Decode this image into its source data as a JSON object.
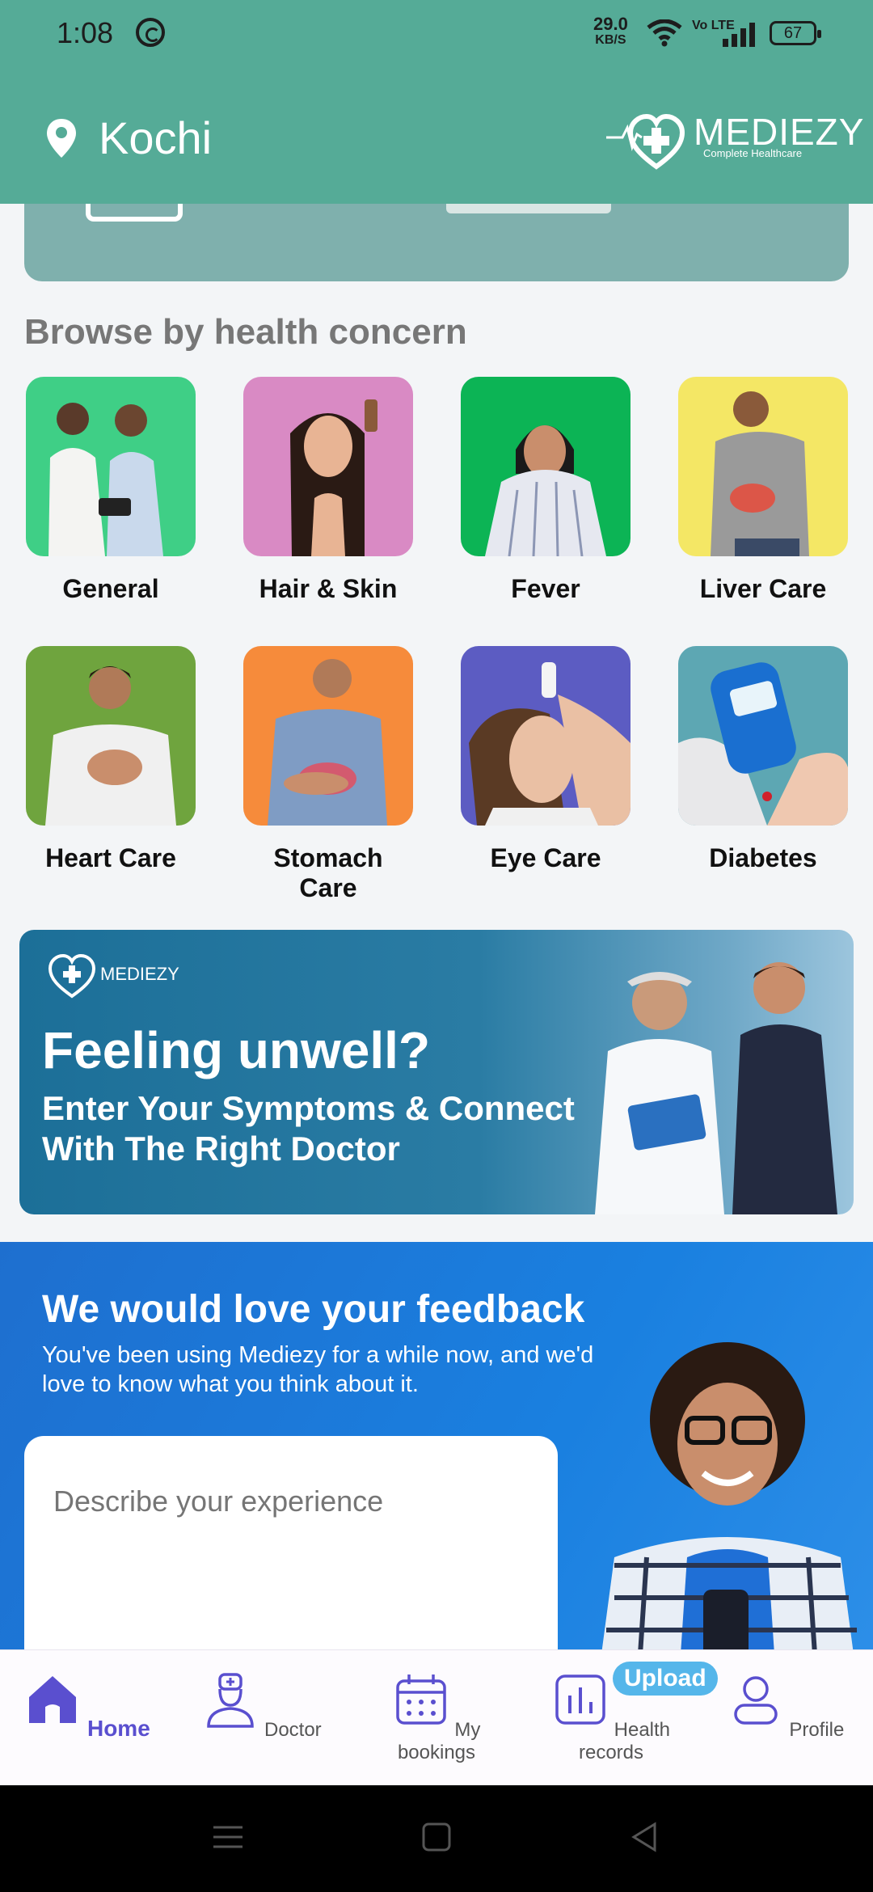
{
  "status_bar": {
    "time": "1:08",
    "net_speed": "29.0",
    "net_unit": "KB/S",
    "volte": "Vo LTE",
    "battery": "67"
  },
  "header": {
    "location": "Kochi",
    "brand": "MEDIEZY",
    "tagline": "Complete Healthcare"
  },
  "section": {
    "title": "Browse by health concern"
  },
  "categories": [
    {
      "label": "General",
      "bg": "#3fcf86"
    },
    {
      "label": "Hair & Skin",
      "bg": "#d98ac4"
    },
    {
      "label": "Fever",
      "bg": "#0cb455"
    },
    {
      "label": "Liver Care",
      "bg": "#f4e765"
    },
    {
      "label": "Heart Care",
      "bg": "#6fa43e"
    },
    {
      "label": "Stomach Care",
      "bg": "#f68b3b"
    },
    {
      "label": "Eye Care",
      "bg": "#5c5cc2"
    },
    {
      "label": "Diabetes",
      "bg": "#5da7b3"
    }
  ],
  "promo": {
    "logo_text": "MEDIEZY",
    "headline": "Feeling unwell?",
    "subline": "Enter Your Symptoms & Connect With  The Right Doctor"
  },
  "feedback": {
    "title": "We would love your feedback",
    "subtitle": "You've been using Mediezy for a while now, and we'd love to know what you think about it.",
    "placeholder": "Describe your experience"
  },
  "bottom_nav": {
    "items": [
      {
        "label": "Home",
        "icon": "home-icon"
      },
      {
        "label": "Doctor",
        "icon": "doctor-icon"
      },
      {
        "label": "My bookings",
        "icon": "calendar-icon"
      },
      {
        "label": "Health records",
        "icon": "records-icon"
      },
      {
        "label": "Profile",
        "icon": "profile-icon"
      }
    ],
    "badge": "Upload"
  },
  "colors": {
    "header": "#55ab97",
    "accent": "#5a4fcf",
    "feedback_bg": "#1a80e0"
  }
}
